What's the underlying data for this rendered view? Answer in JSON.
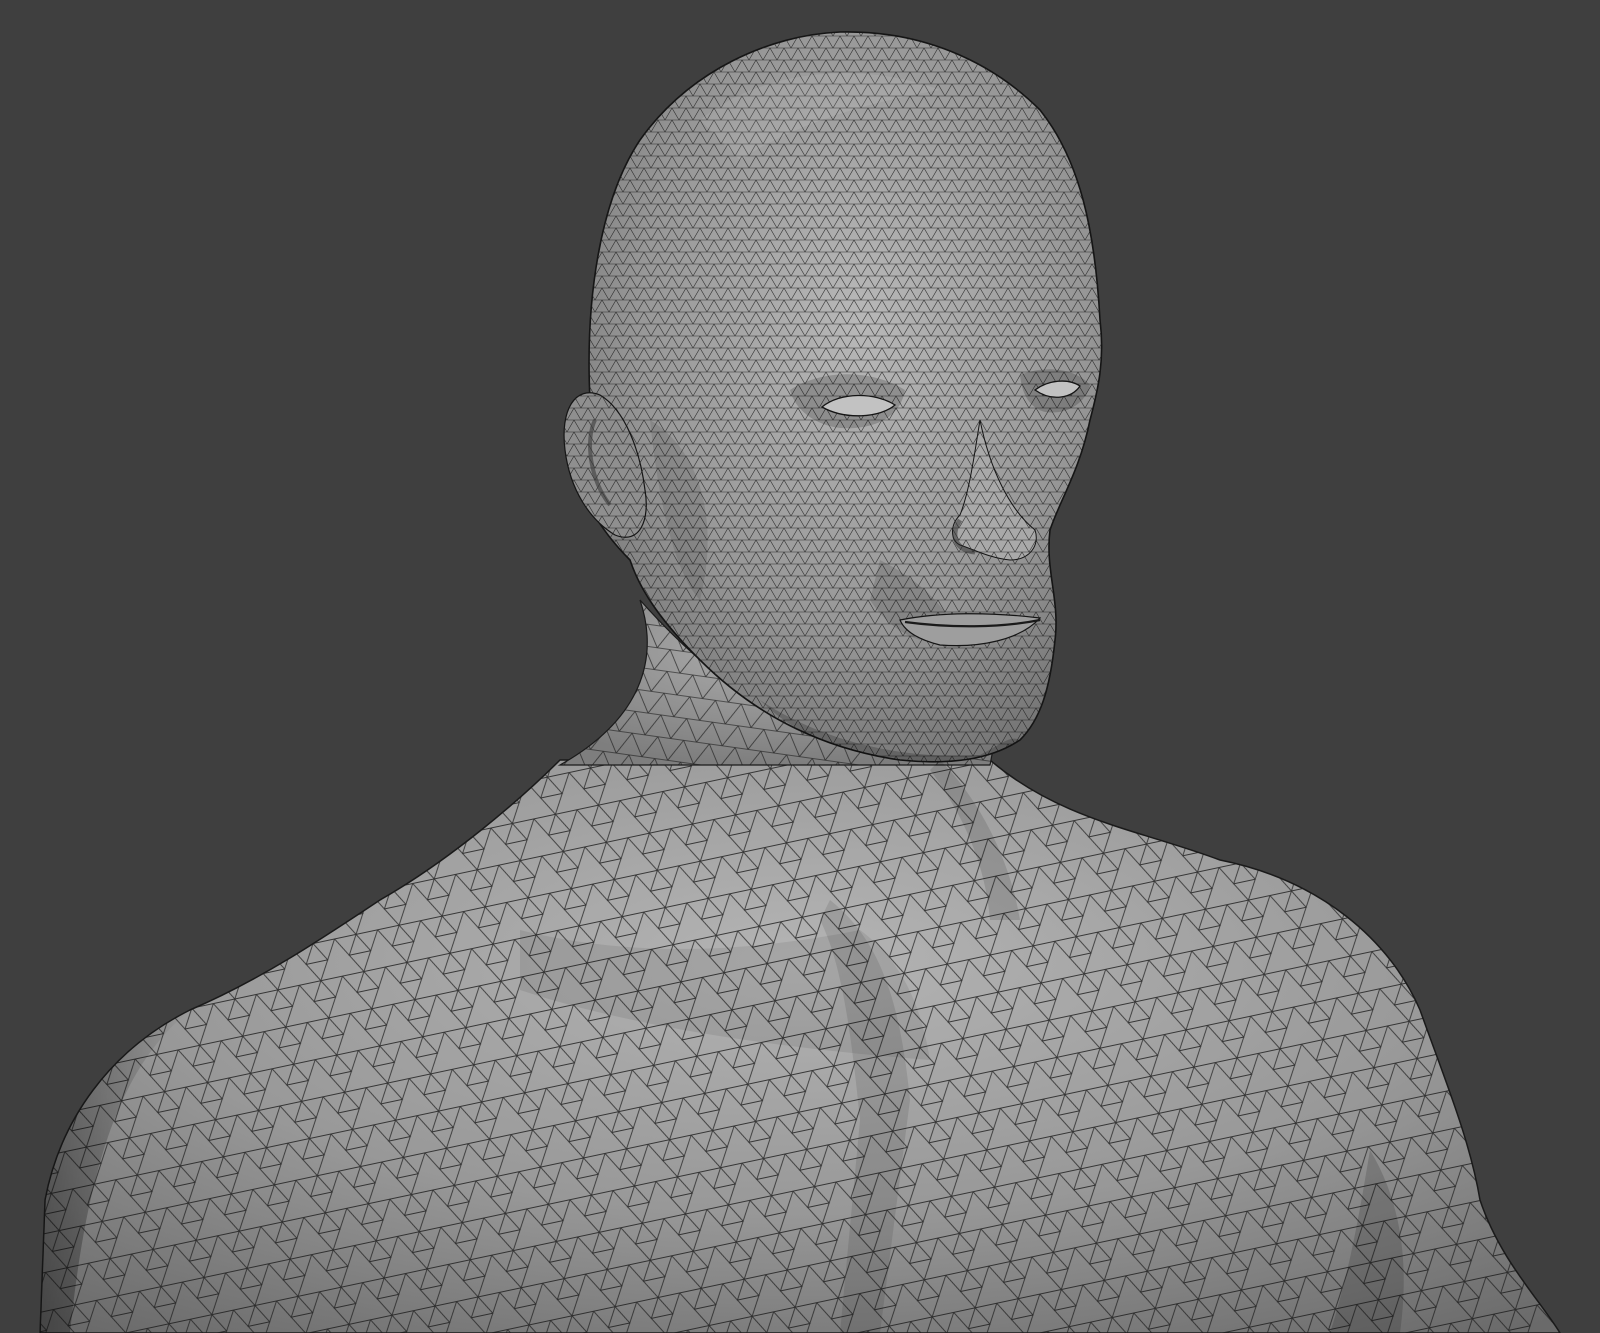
{
  "viewport": {
    "background_color": "#3f3f3f",
    "mesh_base_color": "#8e8e8e",
    "mesh_highlight_color": "#bdbdbd",
    "mesh_shadow_color": "#5a5a5a",
    "wire_color": "#1a1a1a",
    "shading": "solid",
    "overlay": "wireframe"
  },
  "subject": {
    "description_icon": "human-bust-mesh-icon"
  }
}
